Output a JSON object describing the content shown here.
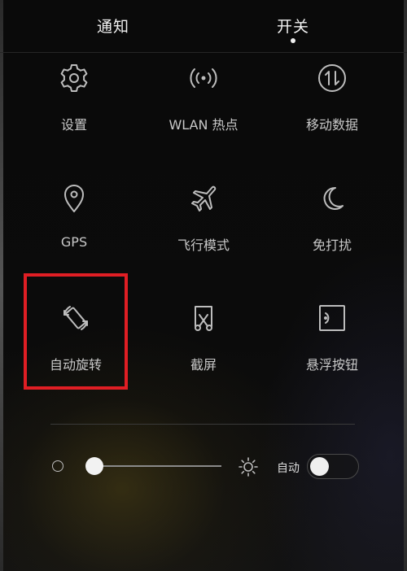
{
  "tabs": {
    "notifications": "通知",
    "toggles": "开关",
    "active": "toggles"
  },
  "toggles": [
    {
      "label": "设置",
      "icon": "gear-icon"
    },
    {
      "label": "WLAN 热点",
      "icon": "hotspot-icon"
    },
    {
      "label": "移动数据",
      "icon": "mobile-data-icon"
    },
    {
      "label": "GPS",
      "icon": "location-pin-icon"
    },
    {
      "label": "飞行模式",
      "icon": "airplane-icon"
    },
    {
      "label": "免打扰",
      "icon": "moon-icon"
    },
    {
      "label": "自动旋转",
      "icon": "auto-rotate-icon"
    },
    {
      "label": "截屏",
      "icon": "screenshot-icon"
    },
    {
      "label": "悬浮按钮",
      "icon": "floating-button-icon"
    }
  ],
  "highlighted_toggle": "自动旋转",
  "brightness": {
    "level": 0.05,
    "auto_label": "自动",
    "auto_enabled": false
  },
  "colors": {
    "highlight": "#e01e24",
    "icon": "#bdbdbd",
    "label": "#c8c8c8"
  }
}
